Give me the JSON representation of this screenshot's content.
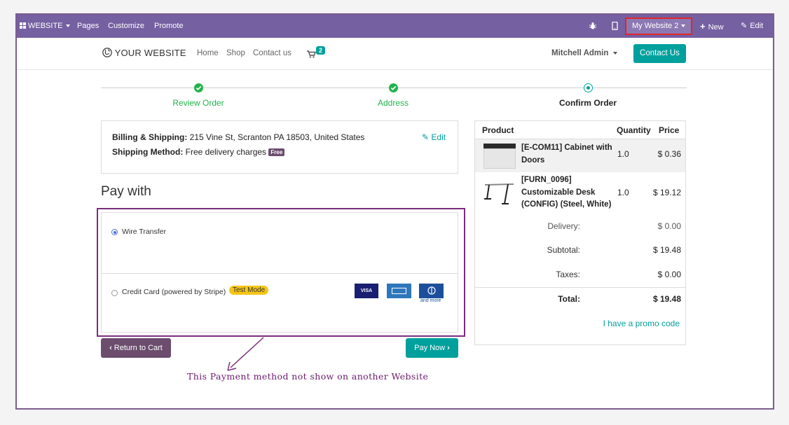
{
  "topbar": {
    "website_menu": "WEBSITE",
    "pages": "Pages",
    "customize": "Customize",
    "promote": "Promote",
    "website_selector": "My Website 2",
    "new": "New",
    "edit": "Edit"
  },
  "header": {
    "logo": "YOUR WEBSITE",
    "nav": [
      "Home",
      "Shop",
      "Contact us"
    ],
    "cart_count": "2",
    "user": "Mitchell Admin",
    "contact_button": "Contact Us"
  },
  "steps": [
    {
      "label": "Review Order",
      "state": "done"
    },
    {
      "label": "Address",
      "state": "done"
    },
    {
      "label": "Confirm Order",
      "state": "current"
    }
  ],
  "billing": {
    "billing_label": "Billing & Shipping:",
    "billing_value": "215 Vine St, Scranton PA 18503, United States",
    "shipping_label": "Shipping Method:",
    "shipping_value": "Free delivery charges",
    "free_badge": "Free",
    "edit": "Edit"
  },
  "payment": {
    "title": "Pay with",
    "options": [
      {
        "label": "Wire Transfer",
        "selected": true
      },
      {
        "label": "Credit Card (powered by Stripe)",
        "selected": false
      }
    ],
    "test_mode": "Test Mode",
    "card_icons": [
      "VISA",
      "AMEX",
      "DINERS"
    ],
    "and_more": "and more",
    "return_button": "Return to Cart",
    "pay_now_button": "Pay Now"
  },
  "annotation": "This Payment method not show on another Website",
  "order": {
    "headers": {
      "product": "Product",
      "quantity": "Quantity",
      "price": "Price"
    },
    "lines": [
      {
        "name": "[E-COM11] Cabinet with Doors",
        "qty": "1.0",
        "price": "$ 0.36"
      },
      {
        "name": "[FURN_0096] Customizable Desk (CONFIG) (Steel, White)",
        "qty": "1.0",
        "price": "$ 19.12"
      }
    ],
    "delivery_label": "Delivery:",
    "delivery_value": "$ 0.00",
    "subtotal_label": "Subtotal:",
    "subtotal_value": "$ 19.48",
    "taxes_label": "Taxes:",
    "taxes_value": "$ 0.00",
    "total_label": "Total:",
    "total_value": "$ 19.48",
    "promo": "I have a promo code"
  },
  "colors": {
    "topbar": "#7560a2",
    "accent": "#00a09d",
    "secondary": "#6c4d6e",
    "done_step": "#21b44b",
    "highlight_border": "#7b2d7e",
    "selector_border": "#e32626"
  }
}
